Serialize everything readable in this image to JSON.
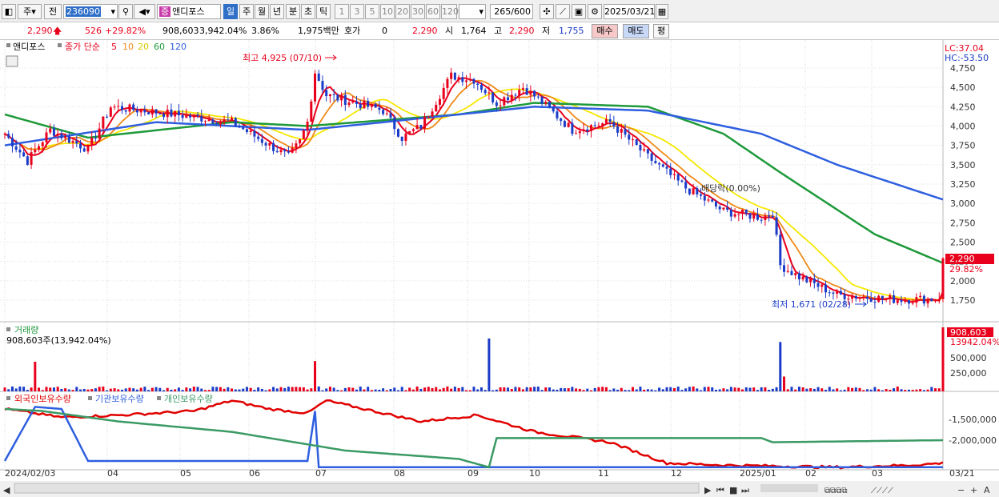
{
  "toolbar": {
    "period": "주",
    "prev_label": "전",
    "code": "236090",
    "name_tag": "증",
    "name": "앤디포스",
    "period_buttons": [
      "일",
      "주",
      "월",
      "년",
      "분",
      "초",
      "틱"
    ],
    "active_period": "일",
    "interval_buttons": [
      "1",
      "3",
      "5",
      "10",
      "20",
      "30",
      "60",
      "120"
    ],
    "count": "265",
    "count_max": "/600",
    "date": "2025/03/21"
  },
  "quote": {
    "price": "2,290",
    "change": "526",
    "change_pct": "+29.82%",
    "volume": "908,603",
    "volume_pct": "3,942.04%",
    "turnover": "3.86%",
    "amount": "1,975백만",
    "hoga_label": "호가",
    "hoga_value": "0",
    "hoga_price": "2,290",
    "open_label": "시",
    "open": "1,764",
    "high_label": "고",
    "high": "2,290",
    "low_label": "저",
    "low": "1,755",
    "buy_label": "매수",
    "sell_label": "매도",
    "eval_label": "평"
  },
  "legend": {
    "name": "앤디포스",
    "price_label": "종가 단순",
    "ma_periods": [
      "5",
      "10",
      "20",
      "60",
      "120"
    ],
    "lc": "LC:37.04",
    "hc": "HC:-53.50"
  },
  "annotations": {
    "high": "최고 4,925 (07/10)",
    "low": "최저 1,671 (02/28)",
    "dividend": "배당락(0.00%)"
  },
  "price_box": {
    "value": "2,290",
    "pct": "29.82%"
  },
  "volume_panel": {
    "title": "거래량",
    "summary": "908,603주(13,942.04%)",
    "box_value": "908,603",
    "box_pct": "13942.04%",
    "ticks": [
      "500,000",
      "250,000"
    ]
  },
  "holdings_panel": {
    "series_labels": [
      "외국인보유수량",
      "기관보유수량",
      "개인보유수량"
    ],
    "ticks": [
      "-1,500,000",
      "-2,000,000"
    ]
  },
  "x_axis": [
    "2024/02/03",
    "04",
    "05",
    "06",
    "07",
    "08",
    "09",
    "10",
    "11",
    "12",
    "2025/01",
    "02",
    "03",
    "03/21"
  ],
  "colors": {
    "up": "#e8001c",
    "down": "#1a3cc8",
    "ma5": "#e8001c",
    "ma10": "#f08a18",
    "ma20": "#f5e800",
    "ma60": "#1e9a3a",
    "ma120": "#2f5fe0",
    "foreign": "#e00000",
    "institution": "#2f5fe0",
    "individual": "#3a9a64"
  },
  "chart_data": {
    "type": "line",
    "title": "앤디포스 종가 단순",
    "x": [
      "2024/02",
      "2024/03",
      "2024/04",
      "2024/05",
      "2024/06",
      "2024/07",
      "2024/08",
      "2024/09",
      "2024/10",
      "2024/11",
      "2024/12",
      "2025/01",
      "2025/02",
      "2025/03/21"
    ],
    "y_ticks": [
      4750,
      4500,
      4250,
      4000,
      3750,
      3500,
      3250,
      3000,
      2750,
      2500,
      2250,
      2000,
      1750
    ],
    "ylim": [
      1650,
      5000
    ],
    "price_keyframes": [
      [
        0,
        3900
      ],
      [
        6,
        3550
      ],
      [
        12,
        3950
      ],
      [
        22,
        3700
      ],
      [
        28,
        4250
      ],
      [
        45,
        4150
      ],
      [
        60,
        4050
      ],
      [
        75,
        3600
      ],
      [
        78,
        3800
      ],
      [
        80,
        4050
      ],
      [
        82,
        4700
      ],
      [
        85,
        4400
      ],
      [
        100,
        4200
      ],
      [
        105,
        3850
      ],
      [
        110,
        4000
      ],
      [
        118,
        4650
      ],
      [
        124,
        4600
      ],
      [
        130,
        4300
      ],
      [
        137,
        4500
      ],
      [
        141,
        4350
      ],
      [
        150,
        3950
      ],
      [
        160,
        4050
      ],
      [
        170,
        3600
      ],
      [
        180,
        3200
      ],
      [
        190,
        2900
      ],
      [
        200,
        2820
      ],
      [
        203,
        2880
      ],
      [
        205,
        2200
      ],
      [
        210,
        2050
      ],
      [
        220,
        1820
      ],
      [
        235,
        1760
      ],
      [
        247,
        1764
      ],
      [
        248,
        2290
      ]
    ],
    "series": [
      {
        "name": "5",
        "values": []
      },
      {
        "name": "10",
        "values": []
      },
      {
        "name": "20",
        "values": []
      },
      {
        "name": "60",
        "values": []
      },
      {
        "name": "120",
        "values": []
      }
    ],
    "ma_keyframes": {
      "60": [
        [
          0,
          4150
        ],
        [
          22,
          3850
        ],
        [
          60,
          4050
        ],
        [
          80,
          4000
        ],
        [
          120,
          4150
        ],
        [
          140,
          4300
        ],
        [
          170,
          4250
        ],
        [
          190,
          3900
        ],
        [
          205,
          3400
        ],
        [
          230,
          2600
        ],
        [
          248,
          2230
        ]
      ],
      "120": [
        [
          0,
          3750
        ],
        [
          40,
          4050
        ],
        [
          80,
          3950
        ],
        [
          140,
          4250
        ],
        [
          170,
          4200
        ],
        [
          200,
          3900
        ],
        [
          220,
          3500
        ],
        [
          248,
          3050
        ]
      ]
    },
    "volume_spikes": [
      [
        8,
        420000
      ],
      [
        82,
        430000
      ],
      [
        128,
        750000
      ],
      [
        205,
        700000
      ],
      [
        206,
        210000
      ],
      [
        248,
        908603
      ]
    ],
    "holdings": {
      "foreign": [
        [
          0,
          -1250000
        ],
        [
          15,
          -1450000
        ],
        [
          30,
          -1400000
        ],
        [
          50,
          -1300000
        ],
        [
          60,
          -1050000
        ],
        [
          70,
          -1250000
        ],
        [
          80,
          -1350000
        ],
        [
          85,
          -1050000
        ],
        [
          100,
          -1350000
        ],
        [
          110,
          -1550000
        ],
        [
          125,
          -1400000
        ],
        [
          140,
          -1800000
        ],
        [
          160,
          -2050000
        ],
        [
          175,
          -2550000
        ],
        [
          190,
          -2600000
        ],
        [
          220,
          -2650000
        ],
        [
          240,
          -2600000
        ],
        [
          248,
          -2550000
        ]
      ],
      "institution": [
        [
          0,
          -2500000
        ],
        [
          8,
          -1200000
        ],
        [
          15,
          -1250000
        ],
        [
          22,
          -2500000
        ],
        [
          80,
          -2500000
        ],
        [
          82,
          -1300000
        ],
        [
          83,
          -2650000
        ],
        [
          248,
          -2650000
        ]
      ],
      "individual": [
        [
          0,
          -1250000
        ],
        [
          10,
          -1300000
        ],
        [
          30,
          -1550000
        ],
        [
          60,
          -1800000
        ],
        [
          90,
          -2250000
        ],
        [
          120,
          -2450000
        ],
        [
          128,
          -2650000
        ],
        [
          130,
          -1950000
        ],
        [
          170,
          -1950000
        ],
        [
          200,
          -1950000
        ],
        [
          203,
          -2050000
        ],
        [
          248,
          -2000000
        ]
      ]
    }
  }
}
